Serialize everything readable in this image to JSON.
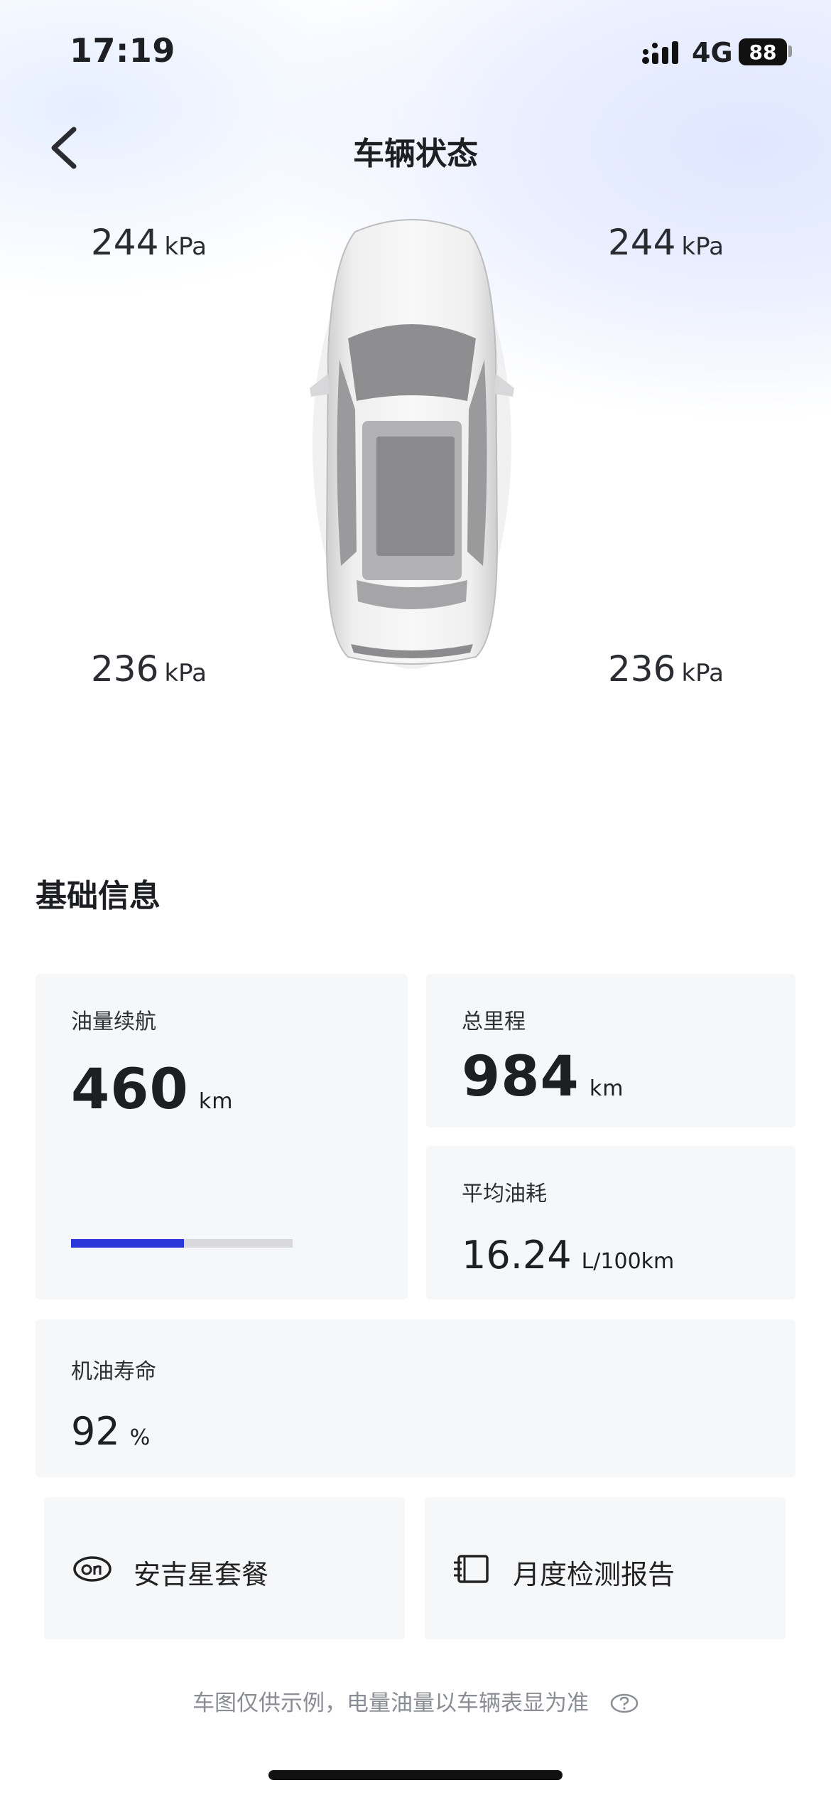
{
  "status_bar": {
    "time": "17:19",
    "network": "4G",
    "battery": "88"
  },
  "header": {
    "title": "车辆状态"
  },
  "tire_pressure": {
    "front_left": {
      "value": "244",
      "unit": "kPa"
    },
    "front_right": {
      "value": "244",
      "unit": "kPa"
    },
    "rear_left": {
      "value": "236",
      "unit": "kPa"
    },
    "rear_right": {
      "value": "236",
      "unit": "kPa"
    }
  },
  "basic_info": {
    "title": "基础信息",
    "fuel_range": {
      "label": "油量续航",
      "value": "460",
      "unit": "km",
      "level": 0.51
    },
    "total_mileage": {
      "label": "总里程",
      "value": "984",
      "unit": "km"
    },
    "avg_consumption": {
      "label": "平均油耗",
      "value": "16.24",
      "unit": "L/100km"
    },
    "oil_life": {
      "label": "机油寿命",
      "value": "92",
      "unit": "%"
    }
  },
  "actions": {
    "package": {
      "label": "安吉星套餐",
      "icon": "onstar-icon"
    },
    "report": {
      "label": "月度检测报告",
      "icon": "report-book-icon"
    }
  },
  "footer": {
    "note": "车图仅供示例，电量油量以车辆表显为准",
    "icon": "help-icon"
  }
}
